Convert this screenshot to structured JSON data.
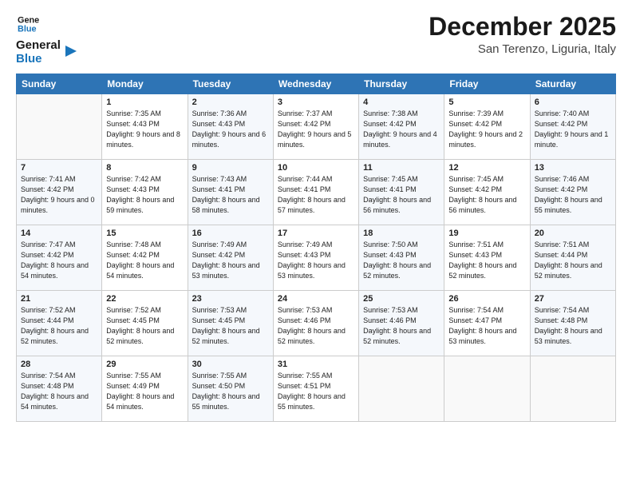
{
  "logo": {
    "line1": "General",
    "line2": "Blue"
  },
  "title": "December 2025",
  "subtitle": "San Terenzo, Liguria, Italy",
  "days_of_week": [
    "Sunday",
    "Monday",
    "Tuesday",
    "Wednesday",
    "Thursday",
    "Friday",
    "Saturday"
  ],
  "weeks": [
    [
      {
        "num": "",
        "sunrise": "",
        "sunset": "",
        "daylight": ""
      },
      {
        "num": "1",
        "sunrise": "Sunrise: 7:35 AM",
        "sunset": "Sunset: 4:43 PM",
        "daylight": "Daylight: 9 hours and 8 minutes."
      },
      {
        "num": "2",
        "sunrise": "Sunrise: 7:36 AM",
        "sunset": "Sunset: 4:43 PM",
        "daylight": "Daylight: 9 hours and 6 minutes."
      },
      {
        "num": "3",
        "sunrise": "Sunrise: 7:37 AM",
        "sunset": "Sunset: 4:42 PM",
        "daylight": "Daylight: 9 hours and 5 minutes."
      },
      {
        "num": "4",
        "sunrise": "Sunrise: 7:38 AM",
        "sunset": "Sunset: 4:42 PM",
        "daylight": "Daylight: 9 hours and 4 minutes."
      },
      {
        "num": "5",
        "sunrise": "Sunrise: 7:39 AM",
        "sunset": "Sunset: 4:42 PM",
        "daylight": "Daylight: 9 hours and 2 minutes."
      },
      {
        "num": "6",
        "sunrise": "Sunrise: 7:40 AM",
        "sunset": "Sunset: 4:42 PM",
        "daylight": "Daylight: 9 hours and 1 minute."
      }
    ],
    [
      {
        "num": "7",
        "sunrise": "Sunrise: 7:41 AM",
        "sunset": "Sunset: 4:42 PM",
        "daylight": "Daylight: 9 hours and 0 minutes."
      },
      {
        "num": "8",
        "sunrise": "Sunrise: 7:42 AM",
        "sunset": "Sunset: 4:43 PM",
        "daylight": "Daylight: 8 hours and 59 minutes."
      },
      {
        "num": "9",
        "sunrise": "Sunrise: 7:43 AM",
        "sunset": "Sunset: 4:41 PM",
        "daylight": "Daylight: 8 hours and 58 minutes."
      },
      {
        "num": "10",
        "sunrise": "Sunrise: 7:44 AM",
        "sunset": "Sunset: 4:41 PM",
        "daylight": "Daylight: 8 hours and 57 minutes."
      },
      {
        "num": "11",
        "sunrise": "Sunrise: 7:45 AM",
        "sunset": "Sunset: 4:41 PM",
        "daylight": "Daylight: 8 hours and 56 minutes."
      },
      {
        "num": "12",
        "sunrise": "Sunrise: 7:45 AM",
        "sunset": "Sunset: 4:42 PM",
        "daylight": "Daylight: 8 hours and 56 minutes."
      },
      {
        "num": "13",
        "sunrise": "Sunrise: 7:46 AM",
        "sunset": "Sunset: 4:42 PM",
        "daylight": "Daylight: 8 hours and 55 minutes."
      }
    ],
    [
      {
        "num": "14",
        "sunrise": "Sunrise: 7:47 AM",
        "sunset": "Sunset: 4:42 PM",
        "daylight": "Daylight: 8 hours and 54 minutes."
      },
      {
        "num": "15",
        "sunrise": "Sunrise: 7:48 AM",
        "sunset": "Sunset: 4:42 PM",
        "daylight": "Daylight: 8 hours and 54 minutes."
      },
      {
        "num": "16",
        "sunrise": "Sunrise: 7:49 AM",
        "sunset": "Sunset: 4:42 PM",
        "daylight": "Daylight: 8 hours and 53 minutes."
      },
      {
        "num": "17",
        "sunrise": "Sunrise: 7:49 AM",
        "sunset": "Sunset: 4:43 PM",
        "daylight": "Daylight: 8 hours and 53 minutes."
      },
      {
        "num": "18",
        "sunrise": "Sunrise: 7:50 AM",
        "sunset": "Sunset: 4:43 PM",
        "daylight": "Daylight: 8 hours and 52 minutes."
      },
      {
        "num": "19",
        "sunrise": "Sunrise: 7:51 AM",
        "sunset": "Sunset: 4:43 PM",
        "daylight": "Daylight: 8 hours and 52 minutes."
      },
      {
        "num": "20",
        "sunrise": "Sunrise: 7:51 AM",
        "sunset": "Sunset: 4:44 PM",
        "daylight": "Daylight: 8 hours and 52 minutes."
      }
    ],
    [
      {
        "num": "21",
        "sunrise": "Sunrise: 7:52 AM",
        "sunset": "Sunset: 4:44 PM",
        "daylight": "Daylight: 8 hours and 52 minutes."
      },
      {
        "num": "22",
        "sunrise": "Sunrise: 7:52 AM",
        "sunset": "Sunset: 4:45 PM",
        "daylight": "Daylight: 8 hours and 52 minutes."
      },
      {
        "num": "23",
        "sunrise": "Sunrise: 7:53 AM",
        "sunset": "Sunset: 4:45 PM",
        "daylight": "Daylight: 8 hours and 52 minutes."
      },
      {
        "num": "24",
        "sunrise": "Sunrise: 7:53 AM",
        "sunset": "Sunset: 4:46 PM",
        "daylight": "Daylight: 8 hours and 52 minutes."
      },
      {
        "num": "25",
        "sunrise": "Sunrise: 7:53 AM",
        "sunset": "Sunset: 4:46 PM",
        "daylight": "Daylight: 8 hours and 52 minutes."
      },
      {
        "num": "26",
        "sunrise": "Sunrise: 7:54 AM",
        "sunset": "Sunset: 4:47 PM",
        "daylight": "Daylight: 8 hours and 53 minutes."
      },
      {
        "num": "27",
        "sunrise": "Sunrise: 7:54 AM",
        "sunset": "Sunset: 4:48 PM",
        "daylight": "Daylight: 8 hours and 53 minutes."
      }
    ],
    [
      {
        "num": "28",
        "sunrise": "Sunrise: 7:54 AM",
        "sunset": "Sunset: 4:48 PM",
        "daylight": "Daylight: 8 hours and 54 minutes."
      },
      {
        "num": "29",
        "sunrise": "Sunrise: 7:55 AM",
        "sunset": "Sunset: 4:49 PM",
        "daylight": "Daylight: 8 hours and 54 minutes."
      },
      {
        "num": "30",
        "sunrise": "Sunrise: 7:55 AM",
        "sunset": "Sunset: 4:50 PM",
        "daylight": "Daylight: 8 hours and 55 minutes."
      },
      {
        "num": "31",
        "sunrise": "Sunrise: 7:55 AM",
        "sunset": "Sunset: 4:51 PM",
        "daylight": "Daylight: 8 hours and 55 minutes."
      },
      {
        "num": "",
        "sunrise": "",
        "sunset": "",
        "daylight": ""
      },
      {
        "num": "",
        "sunrise": "",
        "sunset": "",
        "daylight": ""
      },
      {
        "num": "",
        "sunrise": "",
        "sunset": "",
        "daylight": ""
      }
    ]
  ]
}
